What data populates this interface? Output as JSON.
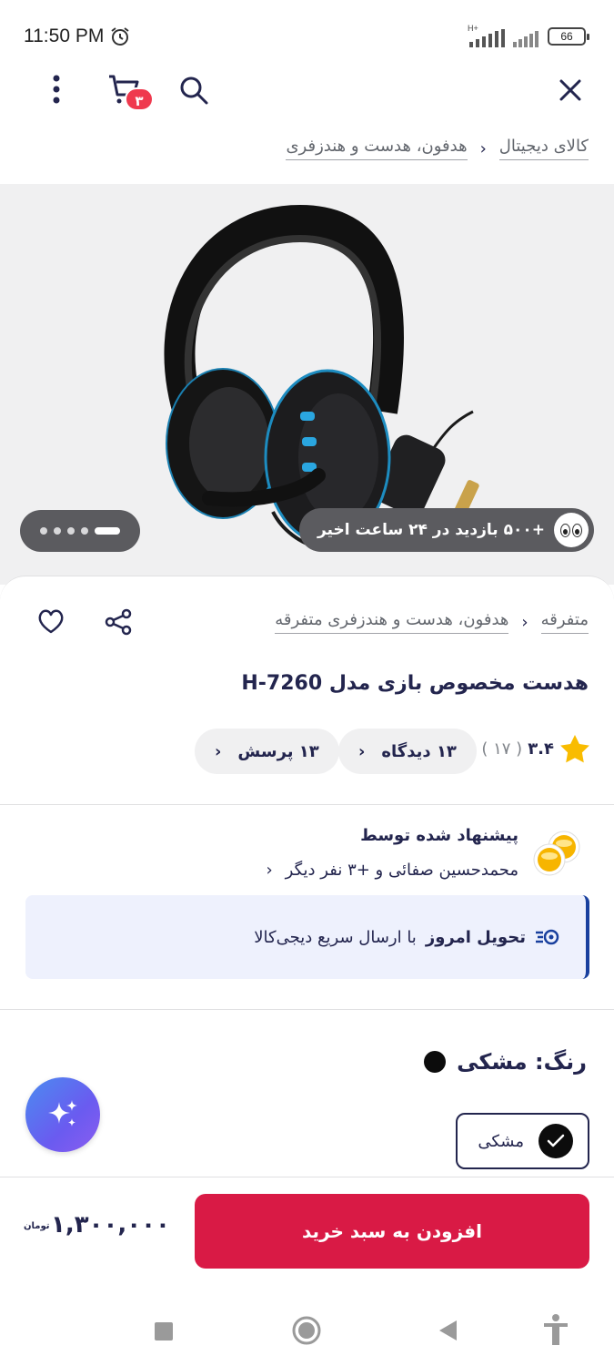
{
  "status_bar": {
    "time": "11:50 PM",
    "battery": "66",
    "network": "H+"
  },
  "app_bar": {
    "cart_count": "۳"
  },
  "breadcrumb_top": {
    "items": [
      "کالای دیجیتال",
      "هدفون، هدست و هندزفری"
    ]
  },
  "gallery": {
    "views_text": "+۵۰۰ بازدید در ۲۴ ساعت اخیر",
    "slide_count": 5,
    "active_slide": 0
  },
  "breadcrumb_mid": {
    "items": [
      "متفرقه",
      "هدفون، هدست و هندزفری متفرقه"
    ]
  },
  "product": {
    "title": "هدست مخصوص بازی مدل H-7260",
    "rating": "۳.۴",
    "rating_count": "( ۱۷ )",
    "reviews_chip": "۱۳ دیدگاه",
    "questions_chip": "۱۳ پرسش"
  },
  "recommendation": {
    "title": "پیشنهاد شده توسط",
    "names": "محمدحسین صفائی و +۳ نفر دیگر"
  },
  "delivery": {
    "bold": "تحویل امروز",
    "text": "با ارسال سریع دیجی‌کالا"
  },
  "color": {
    "label": "رنگ: مشکی",
    "option": "مشکی",
    "swatch": "#0c0c0c"
  },
  "buy": {
    "button": "افزودن به سبد خرید",
    "price": "۱,۳۰۰,۰۰۰",
    "currency": "تومان"
  },
  "colors": {
    "primary_red": "#d91a45",
    "badge_red": "#ef394e",
    "text": "#23254e",
    "delivery_bg": "#eef1fd"
  }
}
